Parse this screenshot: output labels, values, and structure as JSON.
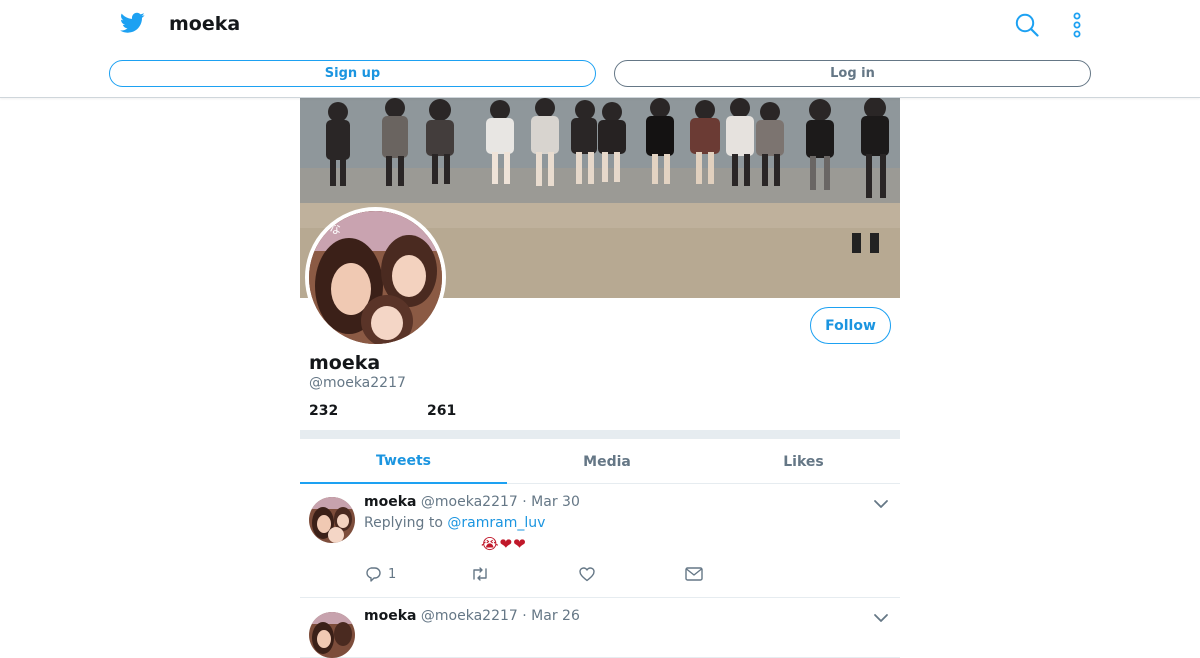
{
  "header": {
    "title": "moeka",
    "signup_label": "Sign up",
    "login_label": "Log in"
  },
  "profile": {
    "name": "moeka",
    "handle": "@moeka2217",
    "stat_1": "232",
    "stat_2": "261",
    "follow_label": "Follow"
  },
  "tabs": [
    {
      "label": "Tweets",
      "active": true
    },
    {
      "label": "Media",
      "active": false
    },
    {
      "label": "Likes",
      "active": false
    }
  ],
  "tweets": [
    {
      "name": "moeka",
      "handle": "@moeka2217",
      "separator": "·",
      "date": "Mar 30",
      "replying_prefix": "Replying to ",
      "replying_to": "@ramram_luv",
      "body": "😭❤❤",
      "reply_count": "1"
    },
    {
      "name": "moeka",
      "handle": "@moeka2217",
      "separator": "·",
      "date": "Mar 26"
    }
  ],
  "colors": {
    "accent": "#1da1f2",
    "accent_text": "#1b95e0",
    "muted": "#657786",
    "divider": "#e6ecf0"
  },
  "icons": [
    "twitter-bird-icon",
    "search-icon",
    "more-vertical-icon",
    "chevron-down-icon",
    "reply-icon",
    "retweet-icon",
    "like-icon",
    "direct-message-icon"
  ]
}
